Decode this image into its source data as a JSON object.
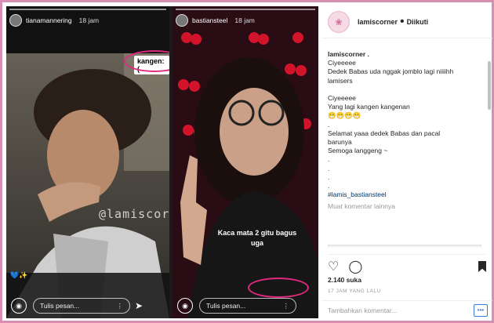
{
  "left_story": {
    "username": "tianamannering",
    "time": "18 jam",
    "sticker": "kangen:(",
    "watermark": "@lamiscorner",
    "emoji": "💙✨",
    "reply_placeholder": "Tulis pesan..."
  },
  "right_story": {
    "username": "bastiansteel",
    "time": "18 jam",
    "caption": "Kaca mata 2 gitu bagus uga",
    "reply_placeholder": "Tulis pesan..."
  },
  "post": {
    "username": "lamiscorner",
    "follow_status": "Diikuti",
    "caption_lines": [
      "lamiscorner .",
      "Ciyeeeee",
      "Dedek Babas uda nggak jomblo lagi niiiihh",
      "lamisers",
      "",
      "Ciyeeeee",
      "Yang lagi kangen kangenan",
      "😁😁😁😁",
      ".",
      "Selamat yaaa dedek Babas dan pacal",
      "barunya",
      "Semoga langgeng ~",
      ".",
      ".",
      ".",
      "."
    ],
    "hashtag": "#lamis_bastiansteel",
    "load_more": "Muat komentar lainnya",
    "likes": "2.140 suka",
    "time_ago": "17 JAM YANG LALU",
    "add_comment_placeholder": "Tambahkan komentar...",
    "more_button": "•••"
  },
  "colors": {
    "border": "#d68fb3",
    "highlight": "#e0287d"
  }
}
